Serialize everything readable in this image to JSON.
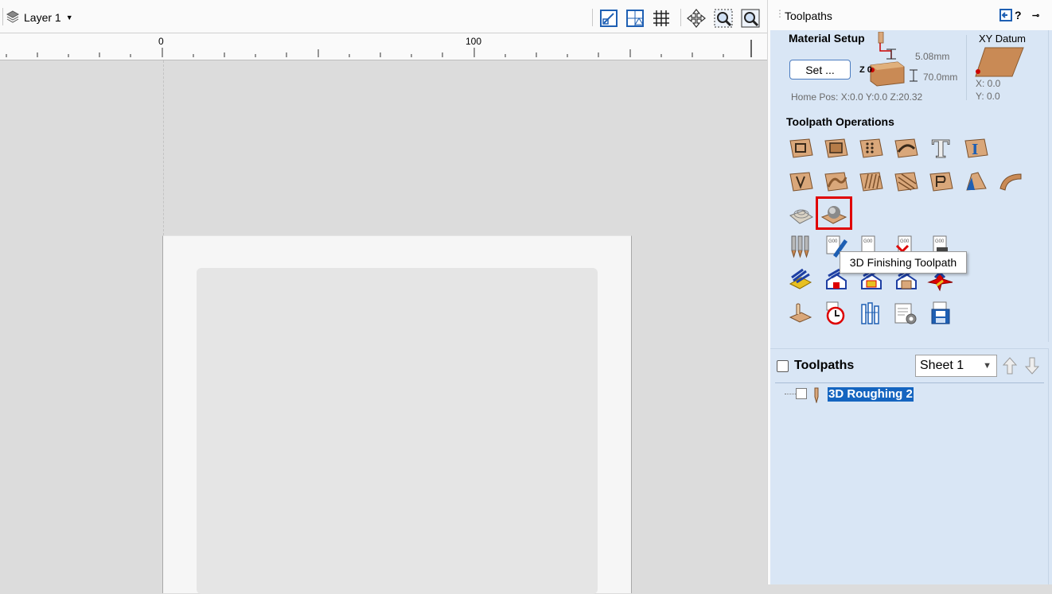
{
  "toolbar": {
    "layer_label": "Layer 1",
    "icons": [
      "layer-stack-icon",
      "dropdown-arrow-icon",
      "set-job-origin-icon",
      "snap-grid-settings-icon",
      "grid-icon",
      "pan-icon",
      "zoom-box-icon",
      "zoom-extents-icon"
    ]
  },
  "ruler": {
    "labels": [
      "0",
      "100"
    ]
  },
  "panel": {
    "title": "Toolpaths",
    "header_icons": [
      "pin-panel-icon",
      "help-icon",
      "dock-icon"
    ],
    "help_label": "?",
    "material_setup": {
      "title": "Material Setup",
      "set_button": "Set ...",
      "z_label": "Z 0",
      "dim_top": "5.08mm",
      "dim_bottom": "70.0mm",
      "home_pos": "Home Pos:  X:0.0 Y:0.0 Z:20.32"
    },
    "xy_datum": {
      "title": "XY Datum",
      "x": "X: 0.0",
      "y": "Y: 0.0"
    },
    "operations": {
      "title": "Toolpath Operations",
      "rows": [
        [
          "profile-toolpath-icon",
          "pocket-toolpath-icon",
          "drilling-toolpath-icon",
          "fluting-toolpath-icon",
          "vcarve-toolpath-icon",
          "inlay-toolpath-icon"
        ],
        [
          "quick-engrave-icon",
          "texture-toolpath-icon",
          "prism-carve-icon",
          "moulding-toolpath-icon",
          "chamfer-toolpath-icon",
          "roughing-relief-icon",
          "rotary-toolpath-icon"
        ],
        [
          "3d-roughing-icon",
          "3d-finishing-icon"
        ],
        [
          "tool-database-icon",
          "edit-toolpath-icon",
          "gcode-template-icon",
          "delete-toolpath-icon",
          "save-gcode-icon"
        ],
        [
          "preview-toolpath-icon",
          "preview-material-icon",
          "preview-reset-icon",
          "preview-box-icon",
          "preview-xyz-icon"
        ],
        [
          "job-sheet-icon",
          "time-estimate-icon",
          "tool-merge-icon",
          "post-settings-icon",
          "save-toolpath-icon"
        ]
      ],
      "selected": "3d-finishing-icon"
    },
    "tooltip": "3D Finishing Toolpath",
    "toolpaths_list": {
      "title": "Toolpaths",
      "sheet_value": "Sheet 1",
      "items": [
        {
          "label": "3D Roughing 2",
          "checked": false,
          "selected": true
        }
      ]
    }
  },
  "colors": {
    "panel_bg": "#d9e6f5",
    "canvas_bg": "#dcdcdc",
    "selection": "#1565c0",
    "selected_outline": "#e00000",
    "wood": "#d9a77a"
  }
}
